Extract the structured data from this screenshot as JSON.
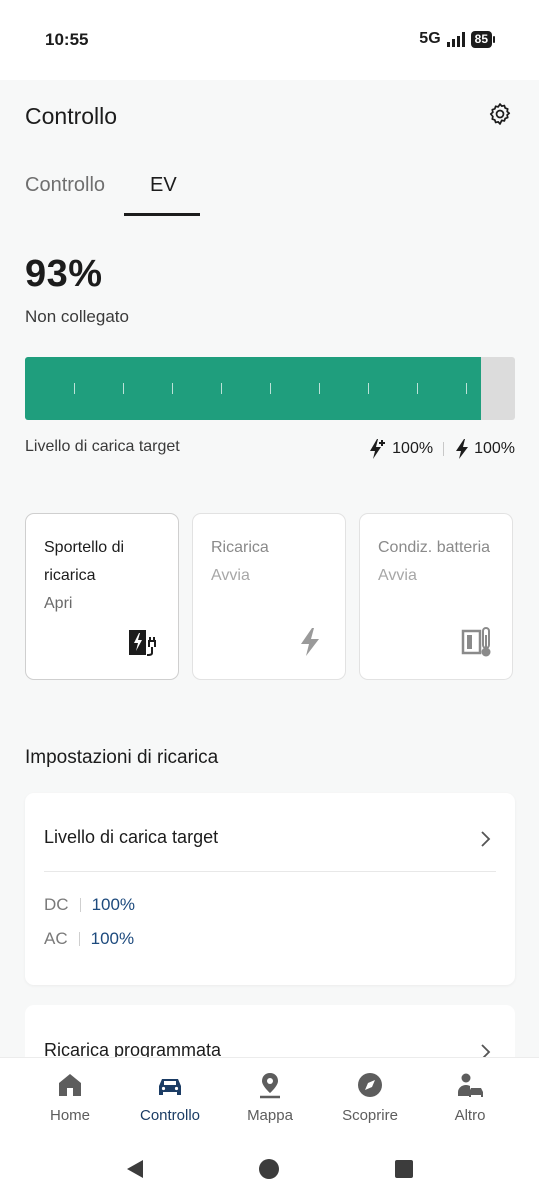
{
  "status_bar": {
    "time": "10:55",
    "network": "5G",
    "battery": "85"
  },
  "header": {
    "title": "Controllo",
    "settings_icon": "gear-icon"
  },
  "tabs": [
    {
      "label": "Controllo",
      "active": false
    },
    {
      "label": "EV",
      "active": true
    }
  ],
  "charge": {
    "percent_text": "93%",
    "level": 0.93,
    "status": "Non collegato",
    "bar_color": "#1f9e7d",
    "target_label": "Livello di carica target",
    "dc_target": "100%",
    "ac_target": "100%"
  },
  "cards": [
    {
      "title": "Sportello di ricarica",
      "subtitle": "Apri",
      "icon": "charging-port-icon",
      "enabled": true
    },
    {
      "title": "Ricarica",
      "subtitle": "Avvia",
      "icon": "lightning-icon",
      "enabled": false
    },
    {
      "title": "Condiz. batteria",
      "subtitle": "Avvia",
      "icon": "battery-thermometer-icon",
      "enabled": false
    }
  ],
  "settings_section": {
    "title": "Impostazioni di ricarica",
    "target_panel": {
      "title": "Livello di carica target",
      "dc_label": "DC",
      "dc_value": "100%",
      "ac_label": "AC",
      "ac_value": "100%"
    },
    "scheduled_panel": {
      "title": "Ricarica programmata"
    }
  },
  "bottom_nav": [
    {
      "label": "Home",
      "icon": "home-icon",
      "active": false
    },
    {
      "label": "Controllo",
      "icon": "car-icon",
      "active": true
    },
    {
      "label": "Mappa",
      "icon": "map-pin-icon",
      "active": false
    },
    {
      "label": "Scoprire",
      "icon": "compass-icon",
      "active": false
    },
    {
      "label": "Altro",
      "icon": "user-car-icon",
      "active": false
    }
  ],
  "colors": {
    "accent_green": "#1f9e7d",
    "nav_active": "#1b3c64",
    "link_blue": "#1d4a7d"
  }
}
